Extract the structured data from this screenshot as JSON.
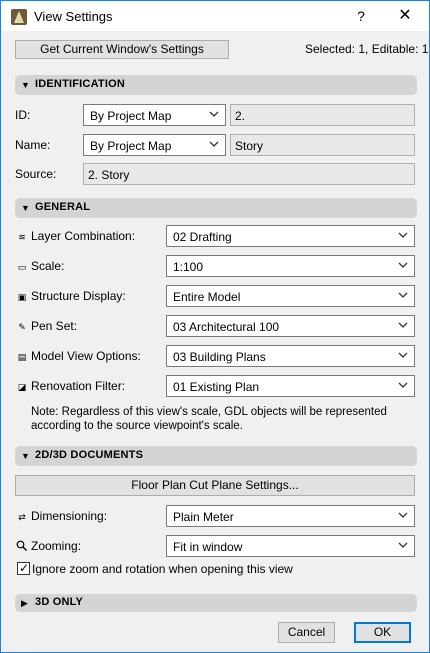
{
  "window": {
    "title": "View Settings",
    "help": "?",
    "close": "✕"
  },
  "top": {
    "get_settings_button": "Get Current Window's Settings",
    "selection_status": "Selected: 1, Editable: 1"
  },
  "identification": {
    "header": "IDENTIFICATION",
    "id_label": "ID:",
    "id_select": "By Project Map",
    "id_value": "2.",
    "name_label": "Name:",
    "name_select": "By Project Map",
    "name_value": "Story",
    "source_label": "Source:",
    "source_value": "2. Story"
  },
  "general": {
    "header": "GENERAL",
    "rows": [
      {
        "label": "Layer Combination:",
        "value": "02 Drafting",
        "icon": "layers-icon"
      },
      {
        "label": "Scale:",
        "value": "1:100",
        "icon": "ruler-icon"
      },
      {
        "label": "Structure Display:",
        "value": "Entire Model",
        "icon": "structure-icon"
      },
      {
        "label": "Pen Set:",
        "value": "03 Architectural 100",
        "icon": "pen-icon"
      },
      {
        "label": "Model View Options:",
        "value": "03 Building Plans",
        "icon": "model-view-icon"
      },
      {
        "label": "Renovation Filter:",
        "value": "01 Existing Plan",
        "icon": "renovation-icon"
      }
    ],
    "note_line1": "Note: Regardless of this view's scale, GDL objects will be represented",
    "note_line2": "according to the source viewpoint's scale."
  },
  "documents": {
    "header": "2D/3D DOCUMENTS",
    "floor_plan_button": "Floor Plan Cut Plane Settings...",
    "dimensioning_label": "Dimensioning:",
    "dimensioning_value": "Plain Meter",
    "zooming_label": "Zooming:",
    "zooming_value": "Fit in window",
    "ignore_zoom_label": "Ignore zoom and rotation when opening this view",
    "ignore_zoom_checked": true
  },
  "three_d": {
    "header": "3D ONLY"
  },
  "footer": {
    "cancel": "Cancel",
    "ok": "OK"
  },
  "colors": {
    "accent": "#0078d7",
    "border": "#1883d7",
    "section_bg": "#d4d4d4",
    "dialog_bg": "#f0f0f0"
  }
}
